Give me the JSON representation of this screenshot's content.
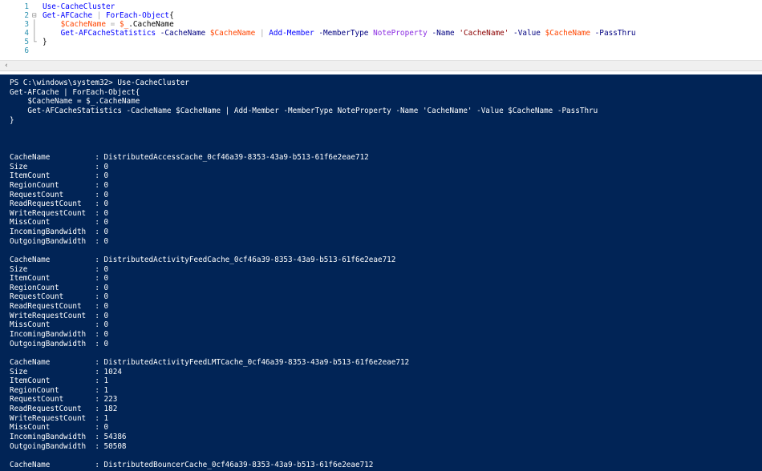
{
  "editor": {
    "lines": [
      {
        "num": "1",
        "fold": "",
        "tokens": [
          {
            "t": "Use-CacheCluster",
            "c": "cmd"
          }
        ]
      },
      {
        "num": "2",
        "fold": "⊟",
        "tokens": [
          {
            "t": "Get-AFCache",
            "c": "cmd"
          },
          {
            "t": " | ",
            "c": "pipe"
          },
          {
            "t": "ForEach-Object",
            "c": "cmd"
          },
          {
            "t": "{",
            "c": "plain"
          }
        ]
      },
      {
        "num": "3",
        "fold": "│",
        "tokens": [
          {
            "t": "    ",
            "c": "plain"
          },
          {
            "t": "$CacheName",
            "c": "var"
          },
          {
            "t": " = ",
            "c": "pipe"
          },
          {
            "t": "$_",
            "c": "var"
          },
          {
            "t": ".CacheName",
            "c": "plain"
          }
        ]
      },
      {
        "num": "4",
        "fold": "│",
        "tokens": [
          {
            "t": "    ",
            "c": "plain"
          },
          {
            "t": "Get-AFCacheStatistics",
            "c": "cmd"
          },
          {
            "t": " -CacheName ",
            "c": "par"
          },
          {
            "t": "$CacheName",
            "c": "var"
          },
          {
            "t": " | ",
            "c": "pipe"
          },
          {
            "t": "Add-Member",
            "c": "cmd"
          },
          {
            "t": " -MemberType ",
            "c": "par"
          },
          {
            "t": "NoteProperty",
            "c": "txt"
          },
          {
            "t": " -Name ",
            "c": "par"
          },
          {
            "t": "'CacheName'",
            "c": "str"
          },
          {
            "t": " -Value ",
            "c": "par"
          },
          {
            "t": "$CacheName",
            "c": "var"
          },
          {
            "t": " -PassThru",
            "c": "par"
          }
        ]
      },
      {
        "num": "5",
        "fold": "└",
        "tokens": [
          {
            "t": "}",
            "c": "plain"
          }
        ]
      },
      {
        "num": "6",
        "fold": "",
        "tokens": []
      }
    ]
  },
  "scrollbar": {
    "left_arrow_icon": "‹"
  },
  "console": {
    "lines": [
      "PS C:\\windows\\system32> Use-CacheCluster",
      "Get-AFCache | ForEach-Object{",
      "    $CacheName = $_.CacheName",
      "    Get-AFCacheStatistics -CacheName $CacheName | Add-Member -MemberType NoteProperty -Name 'CacheName' -Value $CacheName -PassThru",
      "}",
      "",
      "",
      "",
      "CacheName          : DistributedAccessCache_0cf46a39-8353-43a9-b513-61f6e2eae712",
      "Size               : 0",
      "ItemCount          : 0",
      "RegionCount        : 0",
      "RequestCount       : 0",
      "ReadRequestCount   : 0",
      "WriteRequestCount  : 0",
      "MissCount          : 0",
      "IncomingBandwidth  : 0",
      "OutgoingBandwidth  : 0",
      "",
      "CacheName          : DistributedActivityFeedCache_0cf46a39-8353-43a9-b513-61f6e2eae712",
      "Size               : 0",
      "ItemCount          : 0",
      "RegionCount        : 0",
      "RequestCount       : 0",
      "ReadRequestCount   : 0",
      "WriteRequestCount  : 0",
      "MissCount          : 0",
      "IncomingBandwidth  : 0",
      "OutgoingBandwidth  : 0",
      "",
      "CacheName          : DistributedActivityFeedLMTCache_0cf46a39-8353-43a9-b513-61f6e2eae712",
      "Size               : 1024",
      "ItemCount          : 1",
      "RegionCount        : 1",
      "RequestCount       : 223",
      "ReadRequestCount   : 182",
      "WriteRequestCount  : 1",
      "MissCount          : 0",
      "IncomingBandwidth  : 54386",
      "OutgoingBandwidth  : 50508",
      "",
      "CacheName          : DistributedBouncerCache_0cf46a39-8353-43a9-b513-61f6e2eae712"
    ]
  }
}
